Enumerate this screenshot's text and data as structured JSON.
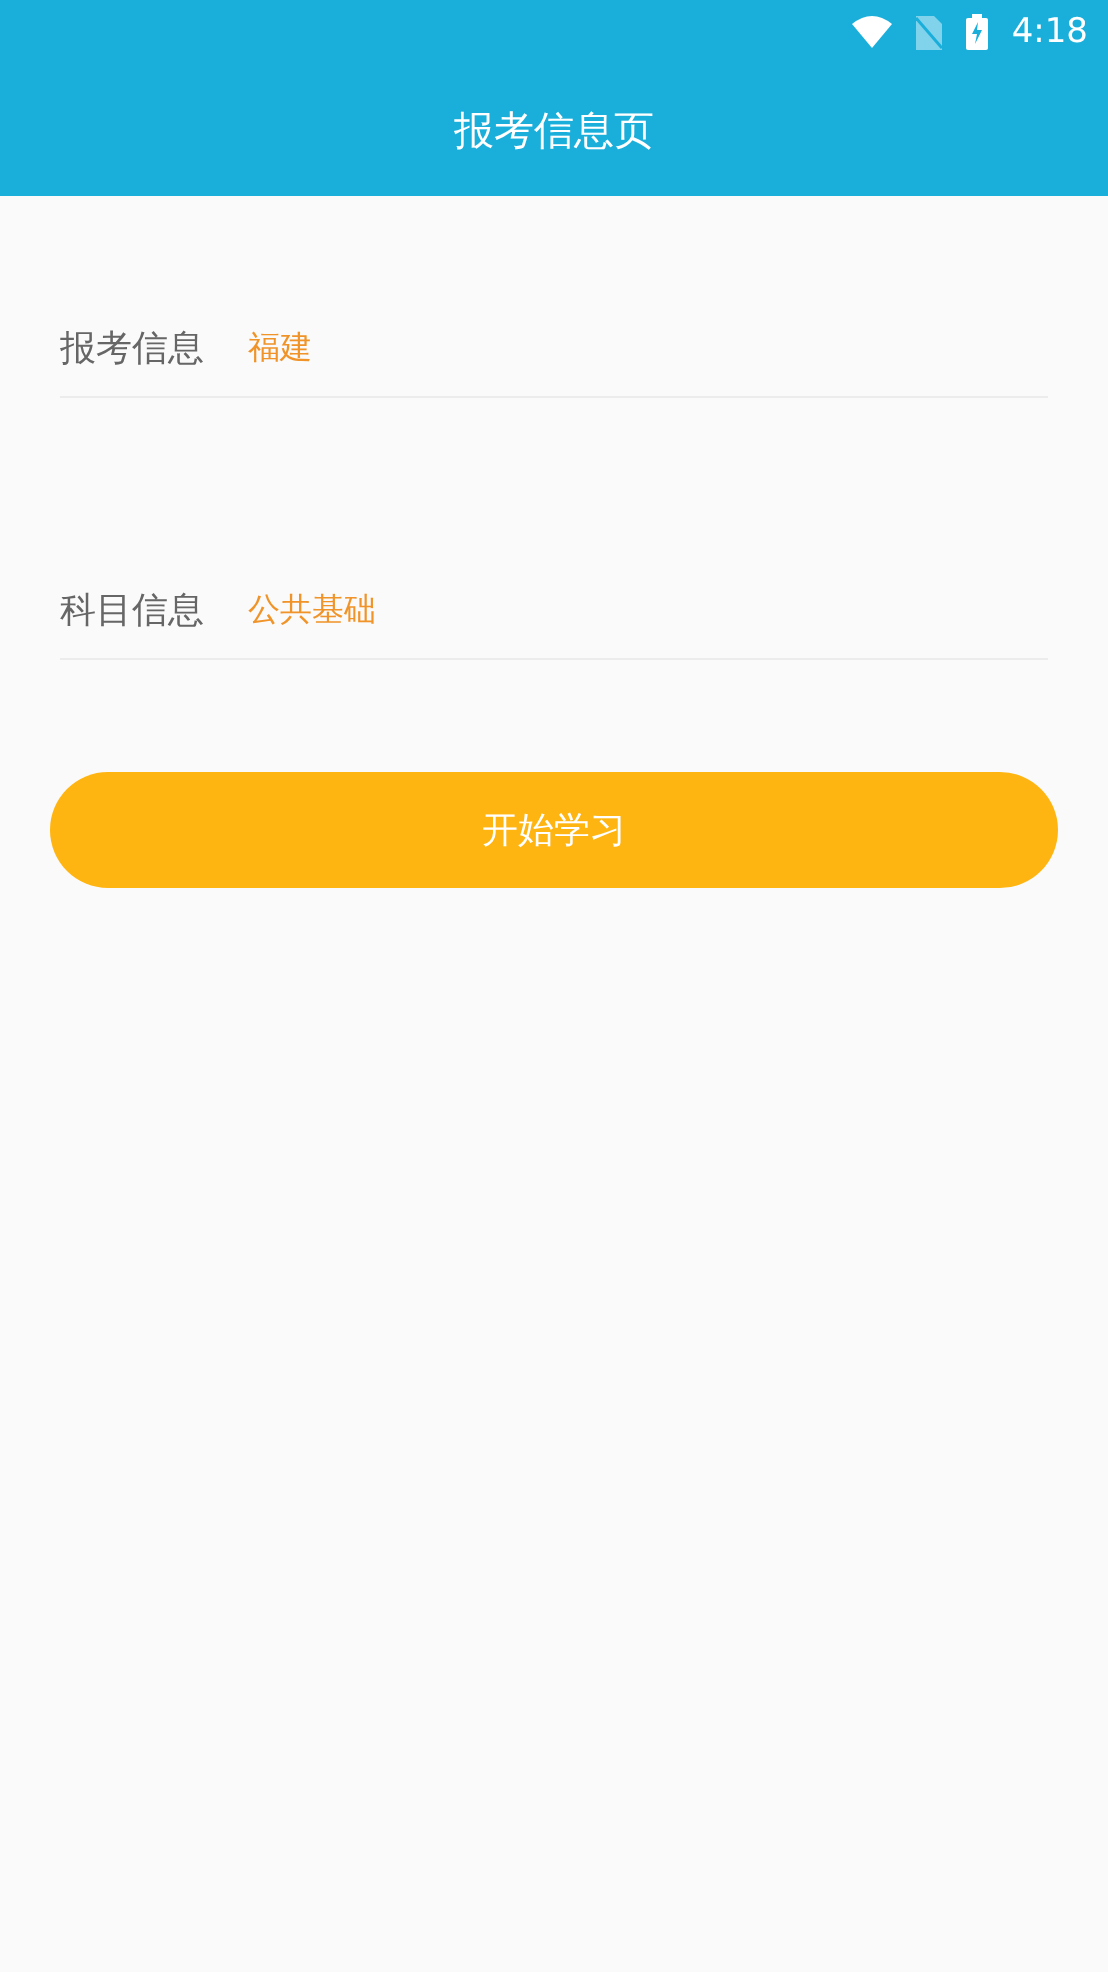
{
  "status_bar": {
    "time": "4:18"
  },
  "app_bar": {
    "title": "报考信息页"
  },
  "fields": [
    {
      "label": "报考信息",
      "value": "福建"
    },
    {
      "label": "科目信息",
      "value": "公共基础"
    }
  ],
  "primary_button": {
    "label": "开始学习"
  }
}
